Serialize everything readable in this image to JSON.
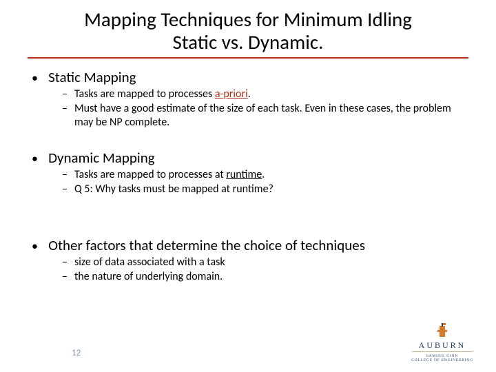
{
  "title_line1": "Mapping Techniques for Minimum Idling",
  "title_line2": "Static vs. Dynamic.",
  "sections": [
    {
      "heading": "Static Mapping",
      "items": [
        {
          "pre": "Tasks are mapped to processes ",
          "hl": "a-priori",
          "post": "."
        },
        {
          "pre": "Must have a good estimate of the size of each task. Even in these cases, the problem may be NP complete.",
          "hl": "",
          "post": ""
        }
      ]
    },
    {
      "heading": "Dynamic Mapping",
      "items": [
        {
          "pre": "Tasks are mapped to processes at ",
          "hl": "runtime",
          "post": "."
        },
        {
          "pre": "Q 5: Why tasks must be mapped at runtime?",
          "hl": "",
          "post": ""
        }
      ]
    },
    {
      "heading": "Other factors that determine the choice of techniques",
      "items": [
        {
          "pre": "size of data associated with a task",
          "hl": "",
          "post": ""
        },
        {
          "pre": "the nature of underlying domain.",
          "hl": "",
          "post": ""
        }
      ]
    }
  ],
  "page_number": "12",
  "logo": {
    "name": "AUBURN",
    "subtitle1": "SAMUEL GINN",
    "subtitle2": "COLLEGE OF ENGINEERING"
  },
  "colors": {
    "accent": "#b82e1b",
    "pagenum": "#7e9ab5",
    "logo_navy": "#1f3a5f"
  }
}
